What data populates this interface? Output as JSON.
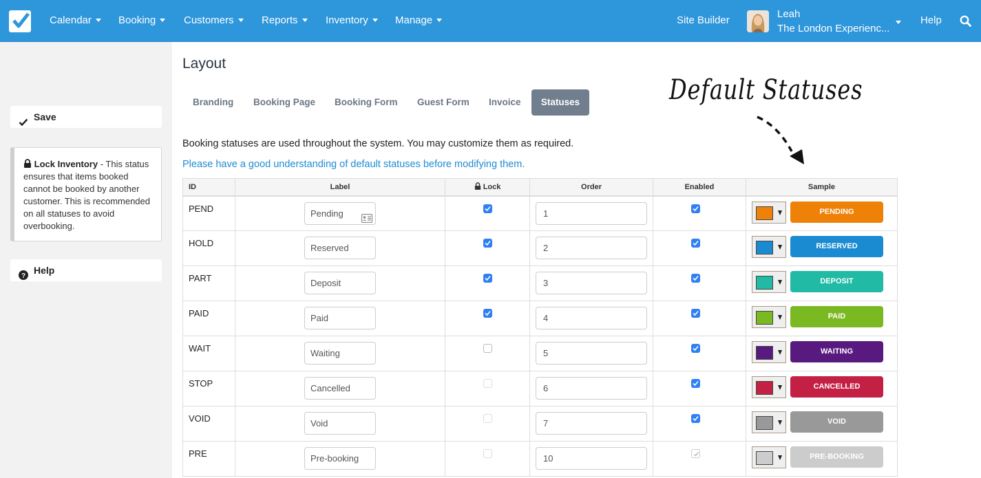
{
  "navbar": {
    "menu": [
      {
        "label": "Calendar"
      },
      {
        "label": "Booking"
      },
      {
        "label": "Customers"
      },
      {
        "label": "Reports"
      },
      {
        "label": "Inventory"
      },
      {
        "label": "Manage"
      }
    ],
    "site_builder": "Site Builder",
    "user_name": "Leah",
    "user_org": "The London Experienc...",
    "help": "Help"
  },
  "sidebar": {
    "save_label": "Save",
    "info_title": "Lock Inventory",
    "info_text": " - This status ensures that items booked cannot be booked by another customer. This is recommended on all statuses to avoid overbooking.",
    "help_label": "Help"
  },
  "main": {
    "title": "Layout",
    "tabs": [
      {
        "label": "Branding"
      },
      {
        "label": "Booking Page"
      },
      {
        "label": "Booking Form"
      },
      {
        "label": "Guest Form"
      },
      {
        "label": "Invoice"
      },
      {
        "label": "Statuses",
        "active": true
      }
    ],
    "description": "Booking statuses are used throughout the system. You may customize them as required.",
    "warning_link": "Please have a good understanding of default statuses before modifying them.",
    "annotation": "Default Statuses"
  },
  "table": {
    "headers": {
      "id": "ID",
      "label": "Label",
      "lock": "Lock",
      "order": "Order",
      "enabled": "Enabled",
      "sample": "Sample"
    },
    "rows": [
      {
        "id": "PEND",
        "label": "Pending",
        "lock": true,
        "order": "1",
        "enabled": true,
        "color": "#ee8208",
        "sample": "PENDING"
      },
      {
        "id": "HOLD",
        "label": "Reserved",
        "lock": true,
        "order": "2",
        "enabled": true,
        "color": "#1b8bd1",
        "sample": "RESERVED"
      },
      {
        "id": "PART",
        "label": "Deposit",
        "lock": true,
        "order": "3",
        "enabled": true,
        "color": "#21bba5",
        "sample": "DEPOSIT"
      },
      {
        "id": "PAID",
        "label": "Paid",
        "lock": true,
        "order": "4",
        "enabled": true,
        "color": "#7ab922",
        "sample": "PAID"
      },
      {
        "id": "WAIT",
        "label": "Waiting",
        "lock": false,
        "order": "5",
        "enabled": true,
        "color": "#591a80",
        "sample": "WAITING"
      },
      {
        "id": "STOP",
        "label": "Cancelled",
        "lock": false,
        "order": "6",
        "enabled": true,
        "color": "#c32044",
        "sample": "CANCELLED"
      },
      {
        "id": "VOID",
        "label": "Void",
        "lock": false,
        "order": "7",
        "enabled": true,
        "color": "#999999",
        "sample": "VOID"
      },
      {
        "id": "PRE",
        "label": "Pre-booking",
        "lock": false,
        "order": "10",
        "enabled": "disabled-checked",
        "color": "#cccccc",
        "sample": "PRE-BOOKING"
      }
    ]
  },
  "icons": {
    "logo": "checkbox-logo-icon",
    "search": "search-icon",
    "save": "check-icon",
    "lock": "lock-icon",
    "help": "question-circle-icon",
    "label_card": "contact-card-icon"
  }
}
